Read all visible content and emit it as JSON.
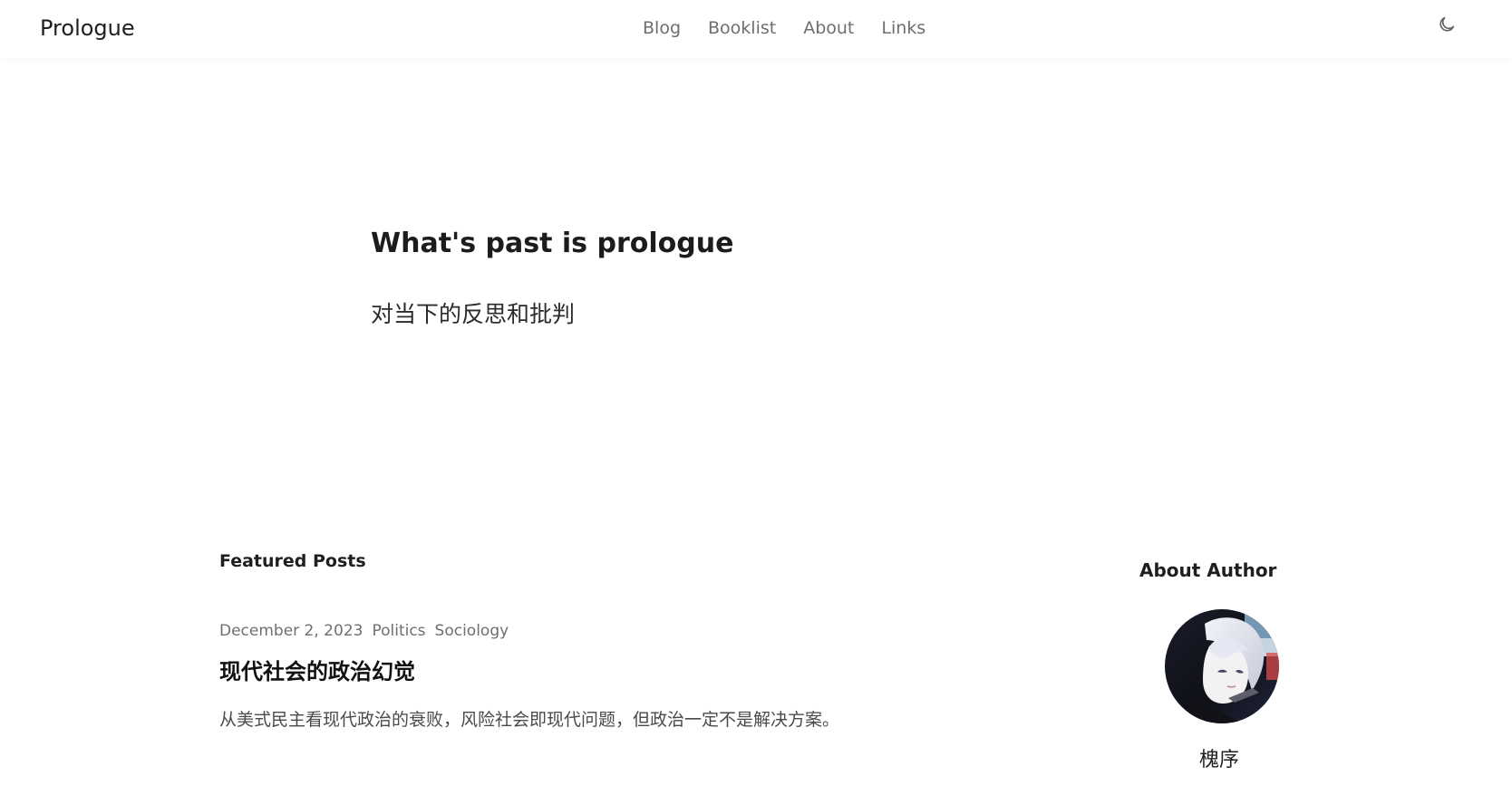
{
  "header": {
    "brand": "Prologue",
    "nav": [
      {
        "label": "Blog"
      },
      {
        "label": "Booklist"
      },
      {
        "label": "About"
      },
      {
        "label": "Links"
      }
    ],
    "theme_toggle_icon": "moon-icon"
  },
  "hero": {
    "title": "What's past is prologue",
    "subtitle": "对当下的反思和批判"
  },
  "featured": {
    "heading": "Featured Posts",
    "posts": [
      {
        "date": "December 2, 2023",
        "tags": [
          "Politics",
          "Sociology"
        ],
        "title": "现代社会的政治幻觉",
        "summary": "从美式民主看现代政治的衰败，风险社会即现代问题，但政治一定不是解决方案。"
      }
    ]
  },
  "sidebar": {
    "heading": "About Author",
    "author_name": "槐序",
    "avatar_icon": "author-avatar"
  },
  "colors": {
    "text_primary": "#1f1f1f",
    "text_muted": "#6f6f6f",
    "background": "#ffffff"
  }
}
